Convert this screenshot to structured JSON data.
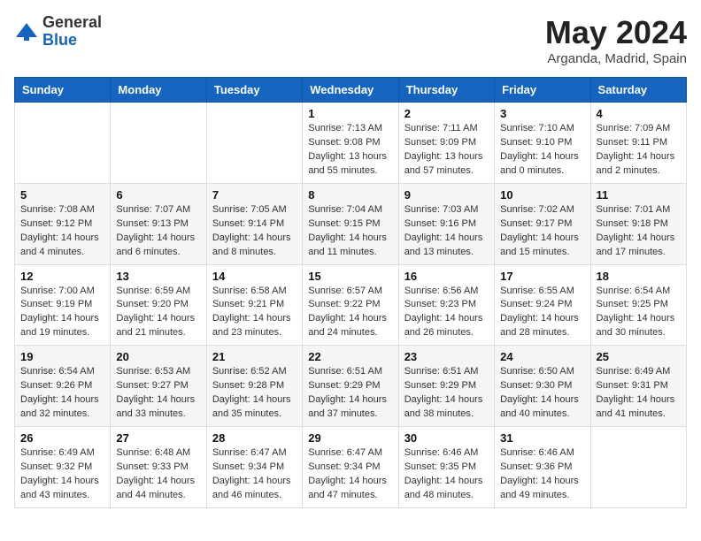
{
  "header": {
    "logo_general": "General",
    "logo_blue": "Blue",
    "title": "May 2024",
    "location": "Arganda, Madrid, Spain"
  },
  "weekdays": [
    "Sunday",
    "Monday",
    "Tuesday",
    "Wednesday",
    "Thursday",
    "Friday",
    "Saturday"
  ],
  "weeks": [
    [
      {
        "day": "",
        "info": []
      },
      {
        "day": "",
        "info": []
      },
      {
        "day": "",
        "info": []
      },
      {
        "day": "1",
        "info": [
          "Sunrise: 7:13 AM",
          "Sunset: 9:08 PM",
          "Daylight: 13 hours",
          "and 55 minutes."
        ]
      },
      {
        "day": "2",
        "info": [
          "Sunrise: 7:11 AM",
          "Sunset: 9:09 PM",
          "Daylight: 13 hours",
          "and 57 minutes."
        ]
      },
      {
        "day": "3",
        "info": [
          "Sunrise: 7:10 AM",
          "Sunset: 9:10 PM",
          "Daylight: 14 hours",
          "and 0 minutes."
        ]
      },
      {
        "day": "4",
        "info": [
          "Sunrise: 7:09 AM",
          "Sunset: 9:11 PM",
          "Daylight: 14 hours",
          "and 2 minutes."
        ]
      }
    ],
    [
      {
        "day": "5",
        "info": [
          "Sunrise: 7:08 AM",
          "Sunset: 9:12 PM",
          "Daylight: 14 hours",
          "and 4 minutes."
        ]
      },
      {
        "day": "6",
        "info": [
          "Sunrise: 7:07 AM",
          "Sunset: 9:13 PM",
          "Daylight: 14 hours",
          "and 6 minutes."
        ]
      },
      {
        "day": "7",
        "info": [
          "Sunrise: 7:05 AM",
          "Sunset: 9:14 PM",
          "Daylight: 14 hours",
          "and 8 minutes."
        ]
      },
      {
        "day": "8",
        "info": [
          "Sunrise: 7:04 AM",
          "Sunset: 9:15 PM",
          "Daylight: 14 hours",
          "and 11 minutes."
        ]
      },
      {
        "day": "9",
        "info": [
          "Sunrise: 7:03 AM",
          "Sunset: 9:16 PM",
          "Daylight: 14 hours",
          "and 13 minutes."
        ]
      },
      {
        "day": "10",
        "info": [
          "Sunrise: 7:02 AM",
          "Sunset: 9:17 PM",
          "Daylight: 14 hours",
          "and 15 minutes."
        ]
      },
      {
        "day": "11",
        "info": [
          "Sunrise: 7:01 AM",
          "Sunset: 9:18 PM",
          "Daylight: 14 hours",
          "and 17 minutes."
        ]
      }
    ],
    [
      {
        "day": "12",
        "info": [
          "Sunrise: 7:00 AM",
          "Sunset: 9:19 PM",
          "Daylight: 14 hours",
          "and 19 minutes."
        ]
      },
      {
        "day": "13",
        "info": [
          "Sunrise: 6:59 AM",
          "Sunset: 9:20 PM",
          "Daylight: 14 hours",
          "and 21 minutes."
        ]
      },
      {
        "day": "14",
        "info": [
          "Sunrise: 6:58 AM",
          "Sunset: 9:21 PM",
          "Daylight: 14 hours",
          "and 23 minutes."
        ]
      },
      {
        "day": "15",
        "info": [
          "Sunrise: 6:57 AM",
          "Sunset: 9:22 PM",
          "Daylight: 14 hours",
          "and 24 minutes."
        ]
      },
      {
        "day": "16",
        "info": [
          "Sunrise: 6:56 AM",
          "Sunset: 9:23 PM",
          "Daylight: 14 hours",
          "and 26 minutes."
        ]
      },
      {
        "day": "17",
        "info": [
          "Sunrise: 6:55 AM",
          "Sunset: 9:24 PM",
          "Daylight: 14 hours",
          "and 28 minutes."
        ]
      },
      {
        "day": "18",
        "info": [
          "Sunrise: 6:54 AM",
          "Sunset: 9:25 PM",
          "Daylight: 14 hours",
          "and 30 minutes."
        ]
      }
    ],
    [
      {
        "day": "19",
        "info": [
          "Sunrise: 6:54 AM",
          "Sunset: 9:26 PM",
          "Daylight: 14 hours",
          "and 32 minutes."
        ]
      },
      {
        "day": "20",
        "info": [
          "Sunrise: 6:53 AM",
          "Sunset: 9:27 PM",
          "Daylight: 14 hours",
          "and 33 minutes."
        ]
      },
      {
        "day": "21",
        "info": [
          "Sunrise: 6:52 AM",
          "Sunset: 9:28 PM",
          "Daylight: 14 hours",
          "and 35 minutes."
        ]
      },
      {
        "day": "22",
        "info": [
          "Sunrise: 6:51 AM",
          "Sunset: 9:29 PM",
          "Daylight: 14 hours",
          "and 37 minutes."
        ]
      },
      {
        "day": "23",
        "info": [
          "Sunrise: 6:51 AM",
          "Sunset: 9:29 PM",
          "Daylight: 14 hours",
          "and 38 minutes."
        ]
      },
      {
        "day": "24",
        "info": [
          "Sunrise: 6:50 AM",
          "Sunset: 9:30 PM",
          "Daylight: 14 hours",
          "and 40 minutes."
        ]
      },
      {
        "day": "25",
        "info": [
          "Sunrise: 6:49 AM",
          "Sunset: 9:31 PM",
          "Daylight: 14 hours",
          "and 41 minutes."
        ]
      }
    ],
    [
      {
        "day": "26",
        "info": [
          "Sunrise: 6:49 AM",
          "Sunset: 9:32 PM",
          "Daylight: 14 hours",
          "and 43 minutes."
        ]
      },
      {
        "day": "27",
        "info": [
          "Sunrise: 6:48 AM",
          "Sunset: 9:33 PM",
          "Daylight: 14 hours",
          "and 44 minutes."
        ]
      },
      {
        "day": "28",
        "info": [
          "Sunrise: 6:47 AM",
          "Sunset: 9:34 PM",
          "Daylight: 14 hours",
          "and 46 minutes."
        ]
      },
      {
        "day": "29",
        "info": [
          "Sunrise: 6:47 AM",
          "Sunset: 9:34 PM",
          "Daylight: 14 hours",
          "and 47 minutes."
        ]
      },
      {
        "day": "30",
        "info": [
          "Sunrise: 6:46 AM",
          "Sunset: 9:35 PM",
          "Daylight: 14 hours",
          "and 48 minutes."
        ]
      },
      {
        "day": "31",
        "info": [
          "Sunrise: 6:46 AM",
          "Sunset: 9:36 PM",
          "Daylight: 14 hours",
          "and 49 minutes."
        ]
      },
      {
        "day": "",
        "info": []
      }
    ]
  ]
}
